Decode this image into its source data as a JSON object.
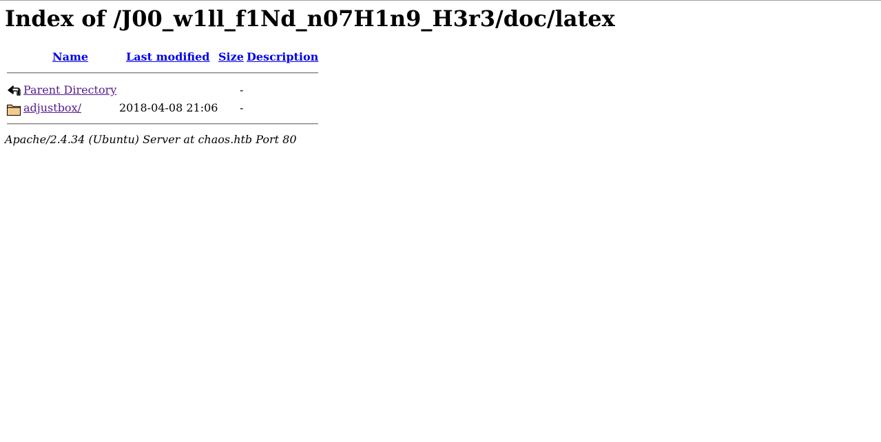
{
  "page": {
    "heading": "Index of /J00_w1ll_f1Nd_n07H1n9_H3r3/doc/latex"
  },
  "table": {
    "columns": {
      "name": "Name",
      "last_modified": "Last modified",
      "size": "Size",
      "description": "Description"
    },
    "rows": [
      {
        "icon": "back-icon",
        "name": "Parent Directory",
        "last_modified": "",
        "size": "-",
        "description": ""
      },
      {
        "icon": "folder-icon",
        "name": "adjustbox/",
        "last_modified": "2018-04-08 21:06",
        "size": "-",
        "description": ""
      }
    ]
  },
  "footer": {
    "address": "Apache/2.4.34 (Ubuntu) Server at chaos.htb Port 80"
  },
  "colors": {
    "link": "#0000ee",
    "visited_link": "#551a8b"
  }
}
